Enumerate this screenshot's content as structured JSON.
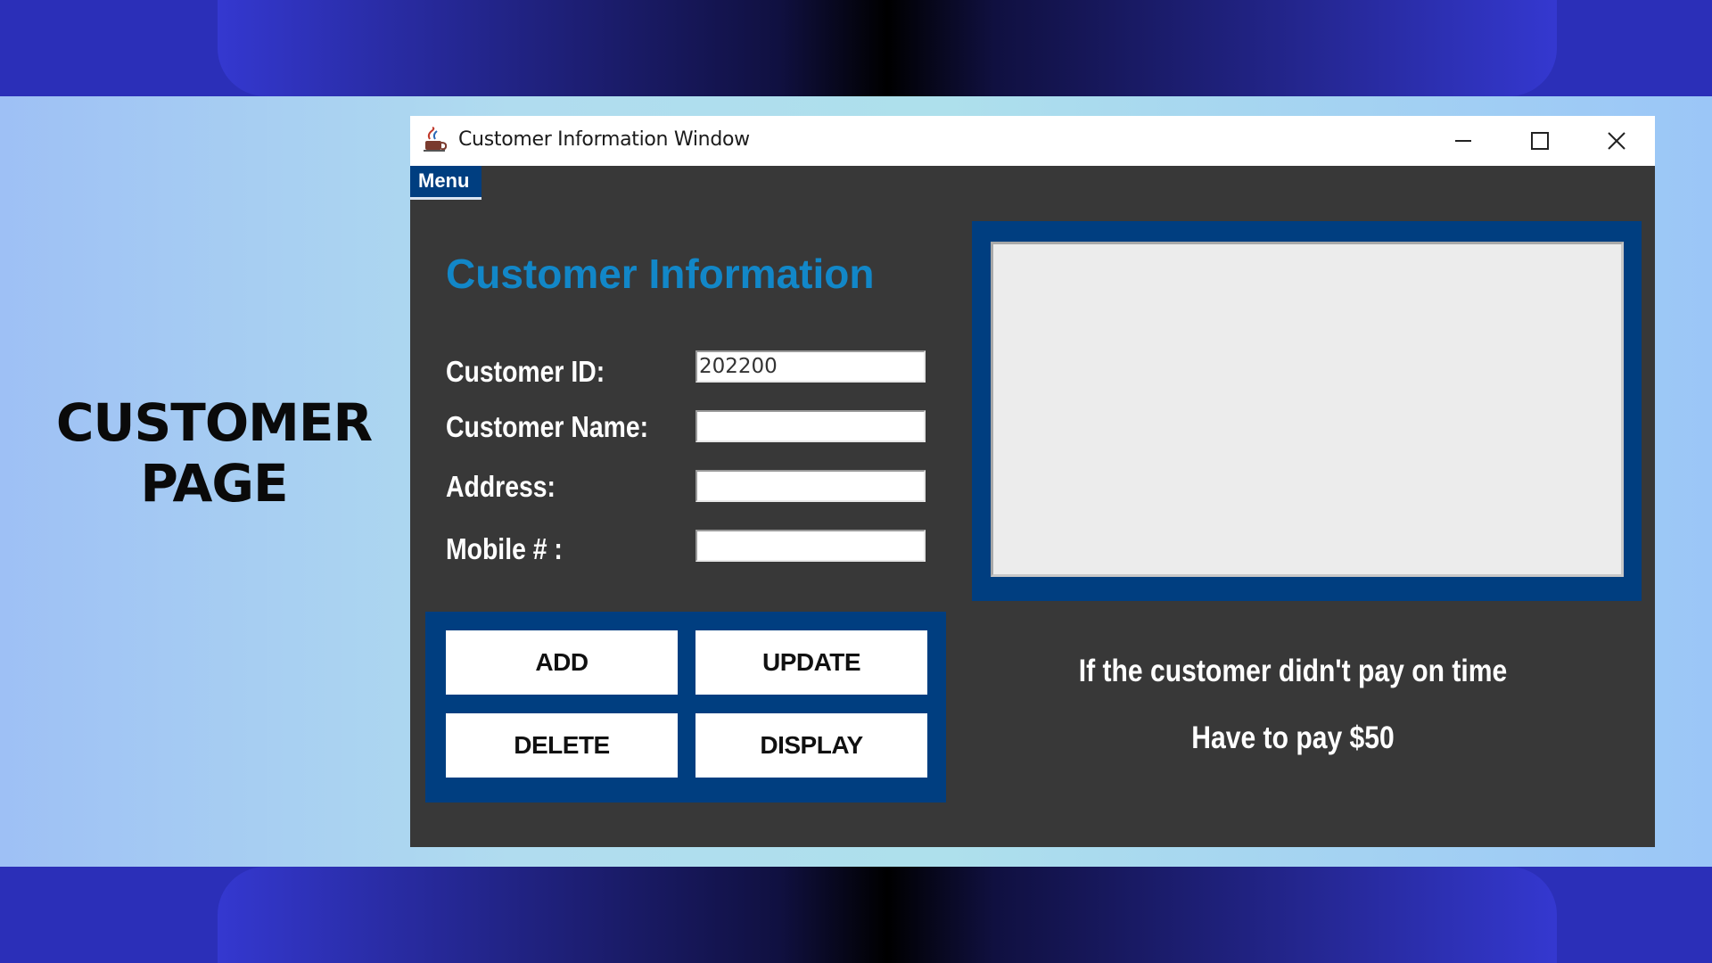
{
  "slide": {
    "title_line1": "CUSTOMER",
    "title_line2": "PAGE"
  },
  "window": {
    "title": "Customer Information Window",
    "app_icon": "java-cup-icon",
    "controls": [
      "minimize-icon",
      "maximize-icon",
      "close-icon"
    ]
  },
  "menu": {
    "label": "Menu"
  },
  "form": {
    "heading": "Customer Information",
    "fields": [
      {
        "label": "Customer ID:",
        "value": "202200"
      },
      {
        "label": "Customer Name:",
        "value": ""
      },
      {
        "label": "Address:",
        "value": ""
      },
      {
        "label": "Mobile # :",
        "value": ""
      }
    ]
  },
  "buttons": {
    "add": "ADD",
    "update": "UPDATE",
    "delete": "DELETE",
    "display": "DISPLAY"
  },
  "display_area": {
    "content": ""
  },
  "notice": {
    "line1": "If the customer didn't pay on time",
    "line2": "Have to pay $50"
  },
  "colors": {
    "panel_blue": "#003e80",
    "heading_blue": "#1287c8",
    "window_bg": "#383838",
    "band_blue": "#2b2fb8"
  }
}
